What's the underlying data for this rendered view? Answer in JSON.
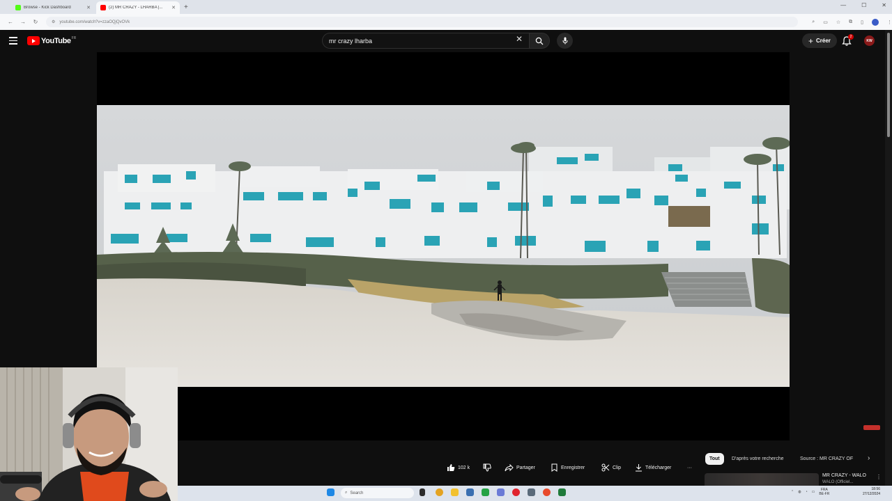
{
  "browser": {
    "tabs": [
      {
        "title": "Browse - Kick Dashboard",
        "favicon_color": "#53fc18",
        "active": false
      },
      {
        "title": "(2) MR CRAZY - LHARBA |...",
        "favicon_color": "#ff0000",
        "active": true
      }
    ],
    "url": "youtube.com/watch?v=zzaOQjQvOVk"
  },
  "youtube": {
    "logo_text": "YouTube",
    "logo_region": "FR",
    "search_query": "mr crazy lharba",
    "create_label": "Créer",
    "notification_count": "2",
    "avatar_text": "KW"
  },
  "actions": {
    "likes": "102 k",
    "share": "Partager",
    "save": "Enregistrer",
    "clip": "Clip",
    "download": "Télécharger",
    "more": "···"
  },
  "filters": {
    "all": "Tout",
    "related": "D'après votre recherche",
    "source": "Source : MR CRAZY OF"
  },
  "sidebar_video": {
    "title": "MR CRAZY - WALO",
    "subtitle": "WALO (Officiel..."
  },
  "taskbar": {
    "search_placeholder": "Search",
    "tray_lang": "FRA",
    "tray_region": "BE-FR",
    "time": "18:56",
    "date": "27/12/2024"
  },
  "colors": {
    "youtube_red": "#ff0000",
    "page_bg": "#0f0f0f",
    "accent_teal": "#2aa3b5"
  }
}
